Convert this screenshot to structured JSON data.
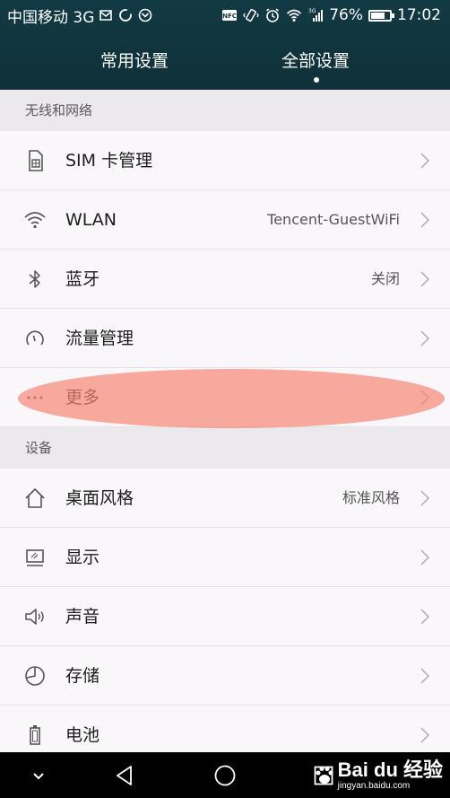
{
  "status_bar": {
    "carrier": "中国移动 3G",
    "battery_percent": "76%",
    "battery_level": 0.76,
    "time": "17:02",
    "net_label": "3G",
    "nfc_label": "NFC"
  },
  "tabs": [
    {
      "label": "常用设置",
      "active": false
    },
    {
      "label": "全部设置",
      "active": true
    }
  ],
  "sections": {
    "wireless": {
      "title": "无线和网络",
      "items": [
        {
          "label": "SIM 卡管理",
          "value": "",
          "icon": "sim-card-icon"
        },
        {
          "label": "WLAN",
          "value": "Tencent-GuestWiFi",
          "icon": "wifi-icon"
        },
        {
          "label": "蓝牙",
          "value": "关闭",
          "icon": "bluetooth-icon"
        },
        {
          "label": "流量管理",
          "value": "",
          "icon": "data-usage-icon"
        },
        {
          "label": "更多",
          "value": "",
          "icon": "more-icon"
        }
      ]
    },
    "device": {
      "title": "设备",
      "items": [
        {
          "label": "桌面风格",
          "value": "标准风格",
          "icon": "home-icon"
        },
        {
          "label": "显示",
          "value": "",
          "icon": "display-icon"
        },
        {
          "label": "声音",
          "value": "",
          "icon": "speaker-icon"
        },
        {
          "label": "存储",
          "value": "",
          "icon": "storage-icon"
        },
        {
          "label": "电池",
          "value": "",
          "icon": "battery-icon"
        }
      ]
    }
  },
  "watermark": {
    "brand": "Bai du 经验",
    "url": "jingyan.baidu.com"
  },
  "colors": {
    "header_bg": "#123a44",
    "highlight": "#f68776",
    "section_bg": "#ebe9eb",
    "row_bg": "#f9f7f9"
  }
}
